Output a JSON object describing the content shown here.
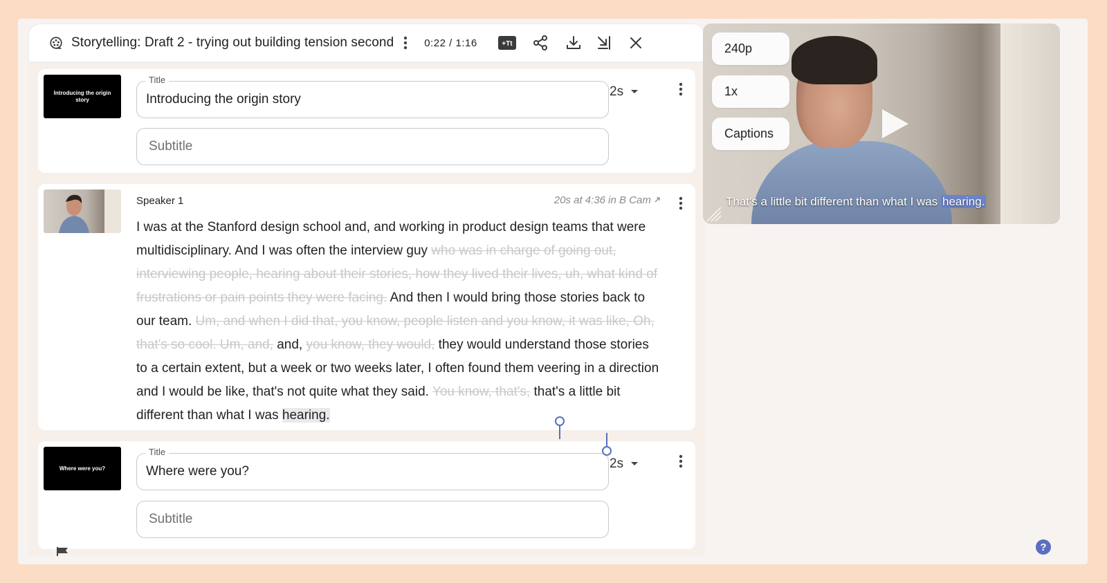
{
  "header": {
    "title": "Storytelling: Draft 2 - trying out building tension second",
    "time": "0:22 / 1:16",
    "caption_btn": "+Tt"
  },
  "cards": {
    "title1": {
      "thumb_text": "Introducing the origin story",
      "title_label": "Title",
      "title_value": "Introducing the origin story",
      "subtitle_placeholder": "Subtitle",
      "duration": "2s"
    },
    "speaker": {
      "name": "Speaker 1",
      "source": "20s at 4:36 in B Cam"
    },
    "title2": {
      "thumb_text": "Where were you?",
      "title_label": "Title",
      "title_value": "Where were you?",
      "subtitle_placeholder": "Subtitle",
      "duration": "2s"
    }
  },
  "transcript": {
    "s1": "I was at the Stanford design school and, and working in product design teams that were multidisciplinary. And I was often the interview guy ",
    "c1": "who was in charge of going out, interviewing people, hearing about their stories, how they lived their lives, uh, what kind of frustrations or pain points they were facing.",
    "s2": " And then I would bring those stories back to our team. ",
    "c2": "Um, and when I did that, you know, people listen and you know, it was like, Oh, that's so cool. Um, and,",
    "s3": " and, ",
    "c3": "you know, they would,",
    "s4": " they would understand those stories to a certain extent, but a week or two weeks later, I often found them veering in a direction and I would be like, that's not quite what they said. ",
    "c4": "You know, that's,",
    "s5": " that's a little bit different than what I was ",
    "sel": "hearing."
  },
  "player": {
    "quality": "240p",
    "speed": "1x",
    "captions": "Captions",
    "caption_text": "That's a little bit different than what I was ",
    "caption_highlight": "hearing."
  },
  "colors": {
    "frame": "#fbdcc4",
    "accent": "#5a6fc0",
    "caption_highlight": "#6b84c9"
  }
}
